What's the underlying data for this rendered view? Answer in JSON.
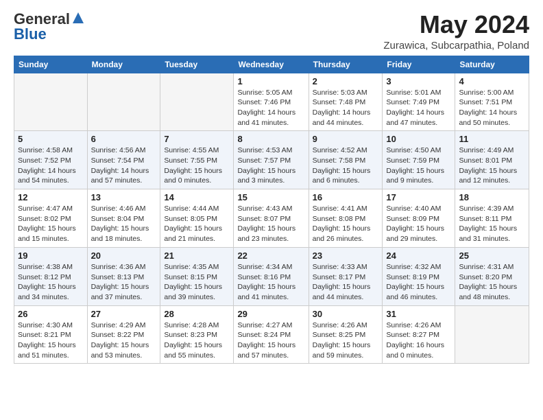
{
  "logo": {
    "general": "General",
    "blue": "Blue"
  },
  "title": {
    "month": "May 2024",
    "location": "Zurawica, Subcarpathia, Poland"
  },
  "weekdays": [
    "Sunday",
    "Monday",
    "Tuesday",
    "Wednesday",
    "Thursday",
    "Friday",
    "Saturday"
  ],
  "weeks": [
    [
      {
        "day": "",
        "info": ""
      },
      {
        "day": "",
        "info": ""
      },
      {
        "day": "",
        "info": ""
      },
      {
        "day": "1",
        "info": "Sunrise: 5:05 AM\nSunset: 7:46 PM\nDaylight: 14 hours\nand 41 minutes."
      },
      {
        "day": "2",
        "info": "Sunrise: 5:03 AM\nSunset: 7:48 PM\nDaylight: 14 hours\nand 44 minutes."
      },
      {
        "day": "3",
        "info": "Sunrise: 5:01 AM\nSunset: 7:49 PM\nDaylight: 14 hours\nand 47 minutes."
      },
      {
        "day": "4",
        "info": "Sunrise: 5:00 AM\nSunset: 7:51 PM\nDaylight: 14 hours\nand 50 minutes."
      }
    ],
    [
      {
        "day": "5",
        "info": "Sunrise: 4:58 AM\nSunset: 7:52 PM\nDaylight: 14 hours\nand 54 minutes."
      },
      {
        "day": "6",
        "info": "Sunrise: 4:56 AM\nSunset: 7:54 PM\nDaylight: 14 hours\nand 57 minutes."
      },
      {
        "day": "7",
        "info": "Sunrise: 4:55 AM\nSunset: 7:55 PM\nDaylight: 15 hours\nand 0 minutes."
      },
      {
        "day": "8",
        "info": "Sunrise: 4:53 AM\nSunset: 7:57 PM\nDaylight: 15 hours\nand 3 minutes."
      },
      {
        "day": "9",
        "info": "Sunrise: 4:52 AM\nSunset: 7:58 PM\nDaylight: 15 hours\nand 6 minutes."
      },
      {
        "day": "10",
        "info": "Sunrise: 4:50 AM\nSunset: 7:59 PM\nDaylight: 15 hours\nand 9 minutes."
      },
      {
        "day": "11",
        "info": "Sunrise: 4:49 AM\nSunset: 8:01 PM\nDaylight: 15 hours\nand 12 minutes."
      }
    ],
    [
      {
        "day": "12",
        "info": "Sunrise: 4:47 AM\nSunset: 8:02 PM\nDaylight: 15 hours\nand 15 minutes."
      },
      {
        "day": "13",
        "info": "Sunrise: 4:46 AM\nSunset: 8:04 PM\nDaylight: 15 hours\nand 18 minutes."
      },
      {
        "day": "14",
        "info": "Sunrise: 4:44 AM\nSunset: 8:05 PM\nDaylight: 15 hours\nand 21 minutes."
      },
      {
        "day": "15",
        "info": "Sunrise: 4:43 AM\nSunset: 8:07 PM\nDaylight: 15 hours\nand 23 minutes."
      },
      {
        "day": "16",
        "info": "Sunrise: 4:41 AM\nSunset: 8:08 PM\nDaylight: 15 hours\nand 26 minutes."
      },
      {
        "day": "17",
        "info": "Sunrise: 4:40 AM\nSunset: 8:09 PM\nDaylight: 15 hours\nand 29 minutes."
      },
      {
        "day": "18",
        "info": "Sunrise: 4:39 AM\nSunset: 8:11 PM\nDaylight: 15 hours\nand 31 minutes."
      }
    ],
    [
      {
        "day": "19",
        "info": "Sunrise: 4:38 AM\nSunset: 8:12 PM\nDaylight: 15 hours\nand 34 minutes."
      },
      {
        "day": "20",
        "info": "Sunrise: 4:36 AM\nSunset: 8:13 PM\nDaylight: 15 hours\nand 37 minutes."
      },
      {
        "day": "21",
        "info": "Sunrise: 4:35 AM\nSunset: 8:15 PM\nDaylight: 15 hours\nand 39 minutes."
      },
      {
        "day": "22",
        "info": "Sunrise: 4:34 AM\nSunset: 8:16 PM\nDaylight: 15 hours\nand 41 minutes."
      },
      {
        "day": "23",
        "info": "Sunrise: 4:33 AM\nSunset: 8:17 PM\nDaylight: 15 hours\nand 44 minutes."
      },
      {
        "day": "24",
        "info": "Sunrise: 4:32 AM\nSunset: 8:19 PM\nDaylight: 15 hours\nand 46 minutes."
      },
      {
        "day": "25",
        "info": "Sunrise: 4:31 AM\nSunset: 8:20 PM\nDaylight: 15 hours\nand 48 minutes."
      }
    ],
    [
      {
        "day": "26",
        "info": "Sunrise: 4:30 AM\nSunset: 8:21 PM\nDaylight: 15 hours\nand 51 minutes."
      },
      {
        "day": "27",
        "info": "Sunrise: 4:29 AM\nSunset: 8:22 PM\nDaylight: 15 hours\nand 53 minutes."
      },
      {
        "day": "28",
        "info": "Sunrise: 4:28 AM\nSunset: 8:23 PM\nDaylight: 15 hours\nand 55 minutes."
      },
      {
        "day": "29",
        "info": "Sunrise: 4:27 AM\nSunset: 8:24 PM\nDaylight: 15 hours\nand 57 minutes."
      },
      {
        "day": "30",
        "info": "Sunrise: 4:26 AM\nSunset: 8:25 PM\nDaylight: 15 hours\nand 59 minutes."
      },
      {
        "day": "31",
        "info": "Sunrise: 4:26 AM\nSunset: 8:27 PM\nDaylight: 16 hours\nand 0 minutes."
      },
      {
        "day": "",
        "info": ""
      }
    ]
  ]
}
